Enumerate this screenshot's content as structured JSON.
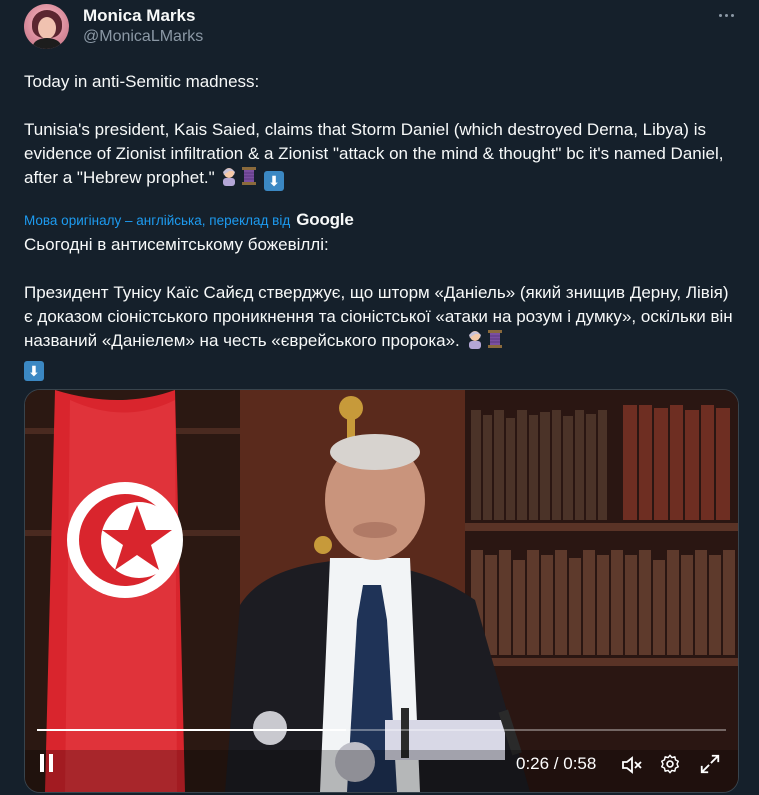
{
  "author": {
    "display_name": "Monica Marks",
    "handle": "@MonicaLMarks"
  },
  "tweet": {
    "text": "Today in anti-Semitic madness:\n\nTunisia's president, Kais Saied, claims that Storm Daniel (which destroyed Derna, Libya) is evidence of Zionist infiltration & a Zionist \"attack on the mind & thought\" bc it's named Daniel, after a \"Hebrew prophet.\"",
    "emojis": [
      "woman-facepalming",
      "spool-of-thread",
      "down-arrow"
    ]
  },
  "translation": {
    "label": "Мова оригіналу – англійська, переклад від",
    "provider": "Google",
    "text": "Сьогодні в антисемітському божевіллі:\n\nПрезидент Тунісу Каїс Сайєд стверджує, що шторм «Даніель» (який знищив Дерну, Лівія) є доказом сіоністського проникнення та сіоністської «атаки на розум і думку», оскільки він названий «Даніелем» на честь «єврейського пророка»."
  },
  "video": {
    "current_time": "0:26",
    "duration": "0:58",
    "time_display": "0:26 / 0:58",
    "progress": 0.448,
    "icons": [
      "pause-icon",
      "mute-icon",
      "settings-icon",
      "fullscreen-icon"
    ]
  },
  "colors": {
    "background": "#15202b",
    "text": "#f7f9f9",
    "secondary": "#8b98a5",
    "link": "#1d9bf0"
  }
}
